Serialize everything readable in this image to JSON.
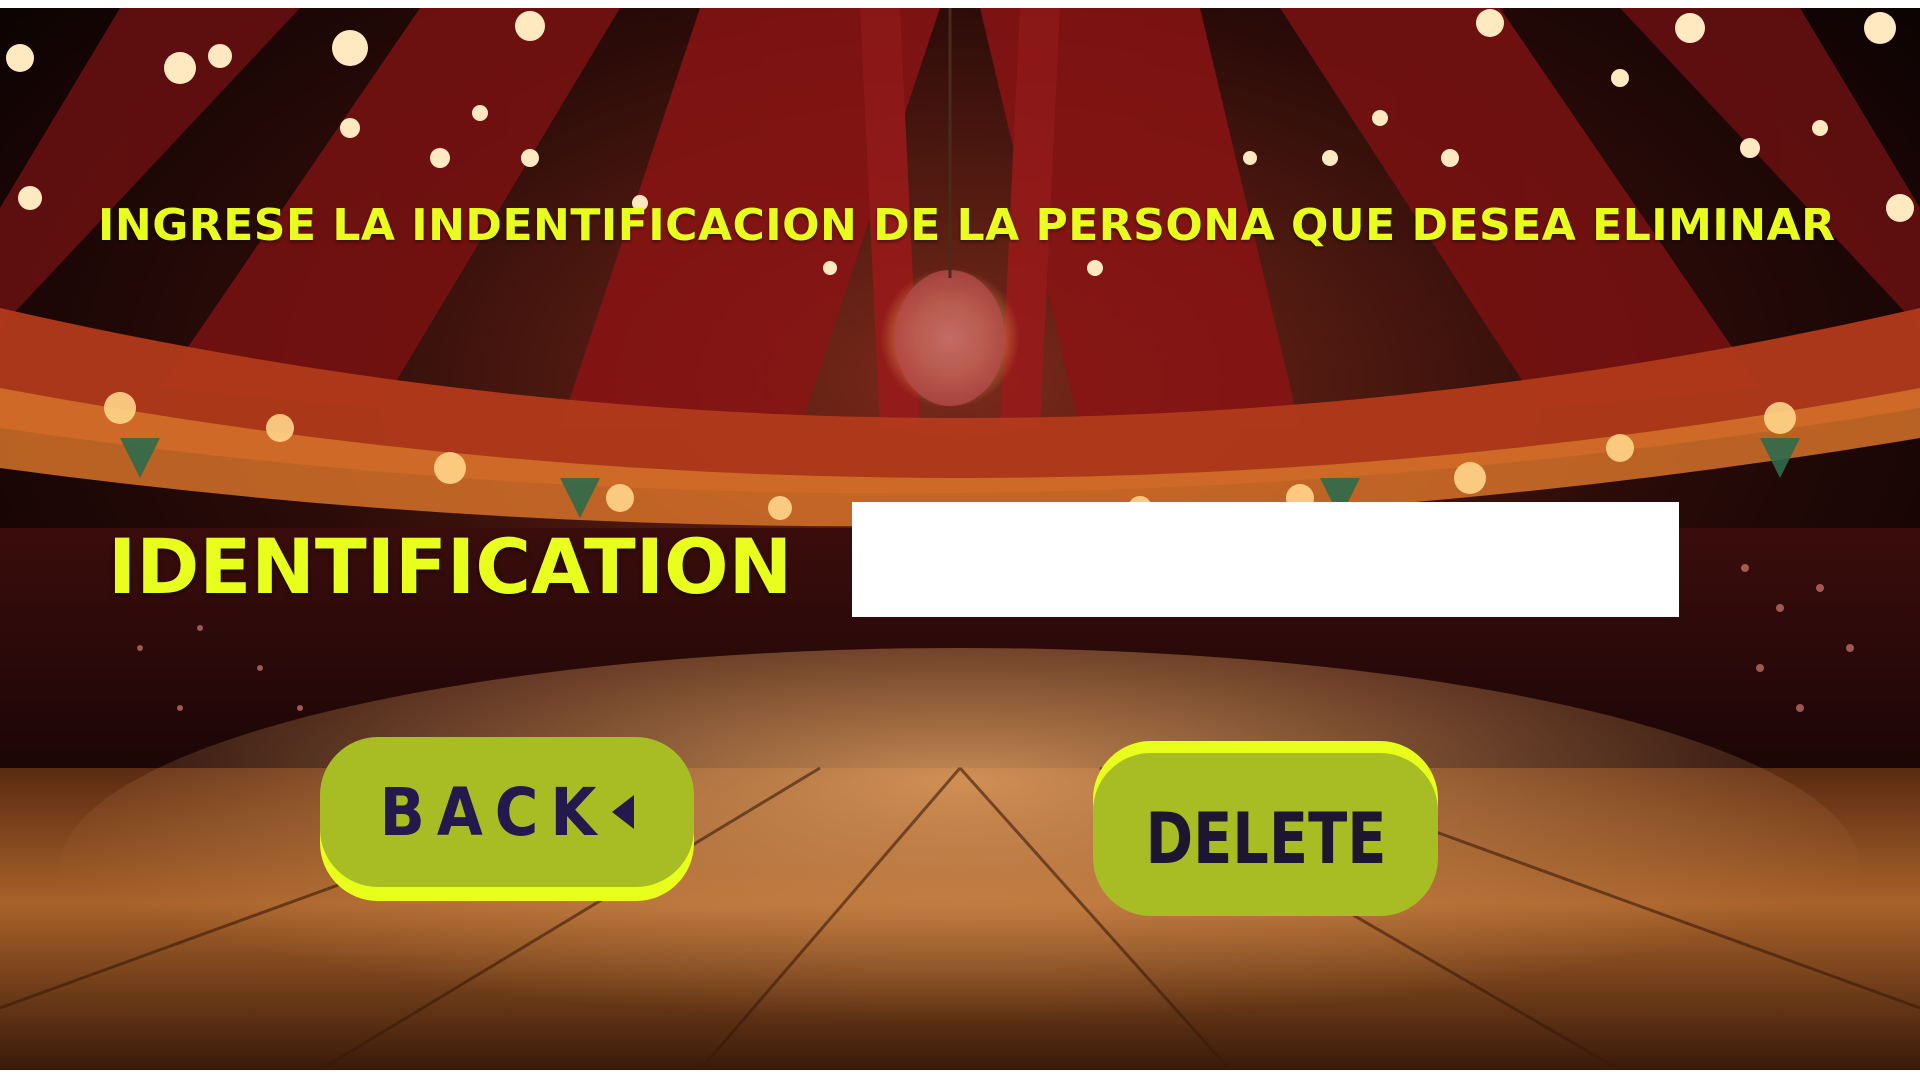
{
  "screen": {
    "instruction": "INGRESE LA INDENTIFICACION DE LA PERSONA QUE DESEA ELIMINAR",
    "field_label": "IDENTIFICATION"
  },
  "form": {
    "identification_value": "",
    "identification_placeholder": ""
  },
  "buttons": {
    "back_label": "BACK",
    "back_icon": "caret-left-icon",
    "delete_label": "DELETE"
  },
  "colors": {
    "text_accent": "#e8ff1e",
    "button_fill": "#a8bc24",
    "button_highlight": "#e7ff1a",
    "button_text": "#23194d"
  }
}
